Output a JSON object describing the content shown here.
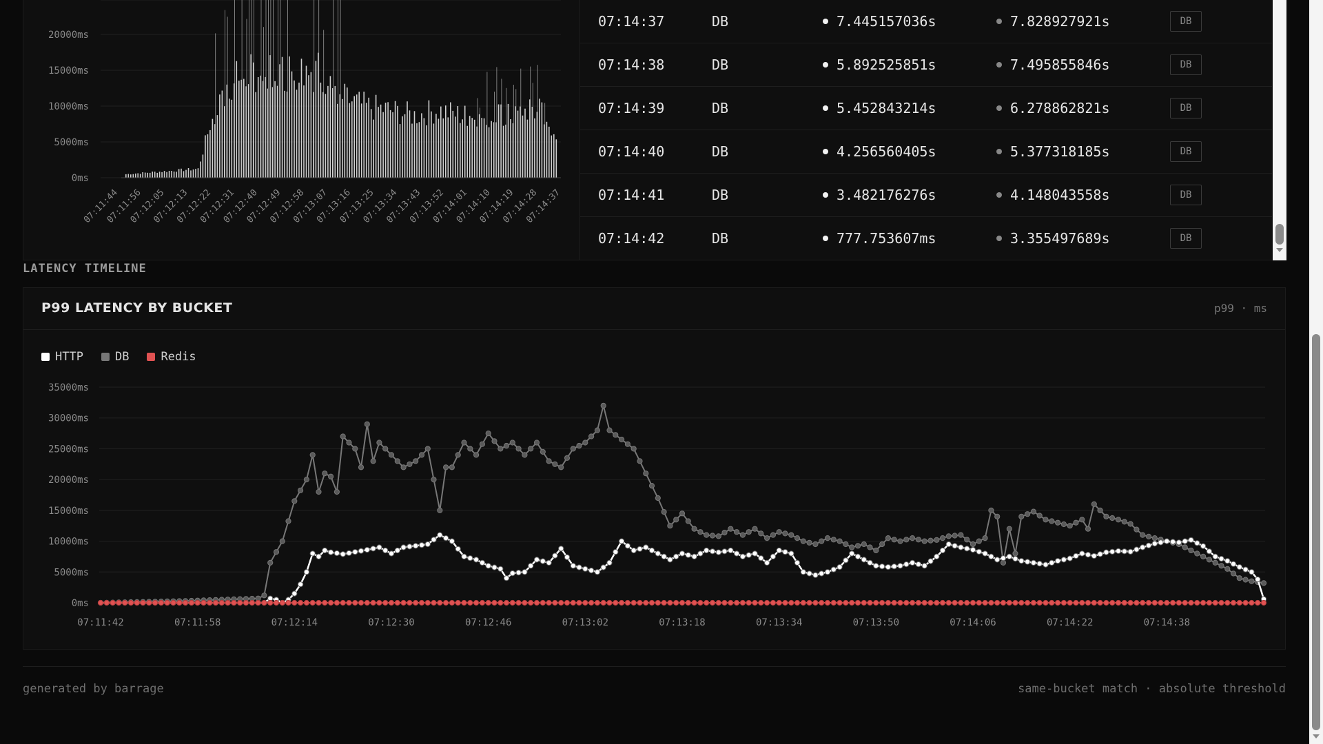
{
  "histogram": {
    "y_ticks": [
      "20000ms",
      "15000ms",
      "10000ms",
      "5000ms",
      "0ms"
    ],
    "x_ticks": [
      "07:11:44",
      "07:11:56",
      "07:12:05",
      "07:12:13",
      "07:12:22",
      "07:12:31",
      "07:12:40",
      "07:12:49",
      "07:12:58",
      "07:13:07",
      "07:13:16",
      "07:13:25",
      "07:13:34",
      "07:13:43",
      "07:13:52",
      "07:14:01",
      "07:14:10",
      "07:14:19",
      "07:14:28",
      "07:14:37"
    ]
  },
  "table": {
    "rows": [
      {
        "time": "07:14:37",
        "source": "DB",
        "v1": "7.445157036s",
        "v2": "7.828927921s",
        "tag": "DB"
      },
      {
        "time": "07:14:38",
        "source": "DB",
        "v1": "5.892525851s",
        "v2": "7.495855846s",
        "tag": "DB"
      },
      {
        "time": "07:14:39",
        "source": "DB",
        "v1": "5.452843214s",
        "v2": "6.278862821s",
        "tag": "DB"
      },
      {
        "time": "07:14:40",
        "source": "DB",
        "v1": "4.256560405s",
        "v2": "5.377318185s",
        "tag": "DB"
      },
      {
        "time": "07:14:41",
        "source": "DB",
        "v1": "3.482176276s",
        "v2": "4.148043558s",
        "tag": "DB"
      },
      {
        "time": "07:14:42",
        "source": "DB",
        "v1": "777.753607ms",
        "v2": "3.355497689s",
        "tag": "DB"
      }
    ]
  },
  "section_label": "LATENCY TIMELINE",
  "chart_panel": {
    "title": "P99 LATENCY BY BUCKET",
    "meta": "p99 · ms"
  },
  "chart_data": {
    "type": "line",
    "title": "P99 LATENCY BY BUCKET",
    "ylabel": "",
    "xlabel": "",
    "ylim": [
      0,
      35000
    ],
    "y_ticks": [
      0,
      5000,
      10000,
      15000,
      20000,
      25000,
      30000,
      35000
    ],
    "y_tick_labels": [
      "0ms",
      "5000ms",
      "10000ms",
      "15000ms",
      "20000ms",
      "25000ms",
      "30000ms",
      "35000ms"
    ],
    "x_tick_labels": [
      "07:11:42",
      "07:11:58",
      "07:12:14",
      "07:12:30",
      "07:12:46",
      "07:13:02",
      "07:13:18",
      "07:13:34",
      "07:13:50",
      "07:14:06",
      "07:14:22",
      "07:14:38"
    ],
    "grid": true,
    "legend": "top-left",
    "x_start": "07:11:42",
    "x_end": "07:14:42",
    "series": [
      {
        "name": "HTTP",
        "color": "#ffffff",
        "keyframes": [
          [
            0,
            0
          ],
          [
            27,
            0
          ],
          [
            28,
            700
          ],
          [
            29,
            500
          ],
          [
            30,
            0
          ],
          [
            31,
            500
          ],
          [
            32,
            1500
          ],
          [
            33,
            3000
          ],
          [
            34,
            5000
          ],
          [
            35,
            8000
          ],
          [
            36,
            7500
          ],
          [
            37,
            8500
          ],
          [
            38,
            8200
          ],
          [
            40,
            7900
          ],
          [
            44,
            8600
          ],
          [
            46,
            9000
          ],
          [
            48,
            8000
          ],
          [
            50,
            9000
          ],
          [
            54,
            9500
          ],
          [
            56,
            11000
          ],
          [
            58,
            10000
          ],
          [
            60,
            7500
          ],
          [
            62,
            7000
          ],
          [
            64,
            6000
          ],
          [
            66,
            5500
          ],
          [
            67,
            4000
          ],
          [
            68,
            4800
          ],
          [
            70,
            5000
          ],
          [
            72,
            7000
          ],
          [
            74,
            6500
          ],
          [
            76,
            8800
          ],
          [
            78,
            6000
          ],
          [
            80,
            5500
          ],
          [
            82,
            5000
          ],
          [
            84,
            6500
          ],
          [
            86,
            10000
          ],
          [
            88,
            8500
          ],
          [
            90,
            9000
          ],
          [
            92,
            8000
          ],
          [
            94,
            7000
          ],
          [
            96,
            8000
          ],
          [
            98,
            7500
          ],
          [
            100,
            8500
          ],
          [
            102,
            8200
          ],
          [
            104,
            8500
          ],
          [
            106,
            7500
          ],
          [
            108,
            8000
          ],
          [
            110,
            6500
          ],
          [
            112,
            8500
          ],
          [
            114,
            8000
          ],
          [
            116,
            5000
          ],
          [
            118,
            4500
          ],
          [
            120,
            5000
          ],
          [
            122,
            5800
          ],
          [
            124,
            8000
          ],
          [
            126,
            7000
          ],
          [
            128,
            6000
          ],
          [
            130,
            5800
          ],
          [
            132,
            6000
          ],
          [
            134,
            6500
          ],
          [
            136,
            6000
          ],
          [
            138,
            7500
          ],
          [
            140,
            9500
          ],
          [
            142,
            9000
          ],
          [
            144,
            8600
          ],
          [
            146,
            8000
          ],
          [
            148,
            7000
          ],
          [
            150,
            7500
          ],
          [
            152,
            6800
          ],
          [
            154,
            6500
          ],
          [
            156,
            6200
          ],
          [
            158,
            6800
          ],
          [
            160,
            7200
          ],
          [
            162,
            8000
          ],
          [
            164,
            7600
          ],
          [
            166,
            8200
          ],
          [
            168,
            8400
          ],
          [
            170,
            8300
          ],
          [
            172,
            9000
          ],
          [
            174,
            9600
          ],
          [
            176,
            10000
          ],
          [
            178,
            9800
          ],
          [
            180,
            10200
          ],
          [
            182,
            9200
          ],
          [
            184,
            7500
          ],
          [
            186,
            6800
          ],
          [
            188,
            5800
          ],
          [
            190,
            5000
          ],
          [
            191,
            3800
          ],
          [
            192,
            600
          ]
        ]
      },
      {
        "name": "DB",
        "color": "#777777",
        "keyframes": [
          [
            0,
            0
          ],
          [
            14,
            300
          ],
          [
            26,
            700
          ],
          [
            27,
            1200
          ],
          [
            28,
            6500
          ],
          [
            30,
            10000
          ],
          [
            32,
            16500
          ],
          [
            34,
            20000
          ],
          [
            35,
            24000
          ],
          [
            36,
            18000
          ],
          [
            37,
            21000
          ],
          [
            38,
            20500
          ],
          [
            39,
            18000
          ],
          [
            40,
            27000
          ],
          [
            42,
            25000
          ],
          [
            43,
            22000
          ],
          [
            44,
            29000
          ],
          [
            45,
            23000
          ],
          [
            46,
            26000
          ],
          [
            48,
            24000
          ],
          [
            50,
            22000
          ],
          [
            52,
            23000
          ],
          [
            54,
            25000
          ],
          [
            56,
            15000
          ],
          [
            57,
            22000
          ],
          [
            58,
            22000
          ],
          [
            60,
            26000
          ],
          [
            62,
            24000
          ],
          [
            64,
            27500
          ],
          [
            66,
            25000
          ],
          [
            68,
            26000
          ],
          [
            70,
            24000
          ],
          [
            72,
            26000
          ],
          [
            74,
            23000
          ],
          [
            76,
            22000
          ],
          [
            78,
            25000
          ],
          [
            80,
            26000
          ],
          [
            82,
            28000
          ],
          [
            83,
            32000
          ],
          [
            84,
            28000
          ],
          [
            86,
            26500
          ],
          [
            88,
            25000
          ],
          [
            90,
            21000
          ],
          [
            92,
            17000
          ],
          [
            94,
            12500
          ],
          [
            96,
            14500
          ],
          [
            98,
            12000
          ],
          [
            100,
            11000
          ],
          [
            102,
            10800
          ],
          [
            104,
            12000
          ],
          [
            106,
            11000
          ],
          [
            108,
            12000
          ],
          [
            110,
            10500
          ],
          [
            112,
            11500
          ],
          [
            114,
            11000
          ],
          [
            116,
            10000
          ],
          [
            118,
            9500
          ],
          [
            120,
            10500
          ],
          [
            122,
            10000
          ],
          [
            124,
            9000
          ],
          [
            126,
            9500
          ],
          [
            128,
            8500
          ],
          [
            130,
            10500
          ],
          [
            132,
            10000
          ],
          [
            134,
            10500
          ],
          [
            136,
            10000
          ],
          [
            138,
            10200
          ],
          [
            140,
            10800
          ],
          [
            142,
            11000
          ],
          [
            144,
            9500
          ],
          [
            146,
            10500
          ],
          [
            147,
            15000
          ],
          [
            148,
            14000
          ],
          [
            149,
            6500
          ],
          [
            150,
            12000
          ],
          [
            151,
            8000
          ],
          [
            152,
            14000
          ],
          [
            154,
            14800
          ],
          [
            156,
            13500
          ],
          [
            158,
            13000
          ],
          [
            160,
            12500
          ],
          [
            162,
            13500
          ],
          [
            163,
            12000
          ],
          [
            164,
            16000
          ],
          [
            166,
            14000
          ],
          [
            168,
            13500
          ],
          [
            170,
            12800
          ],
          [
            172,
            11000
          ],
          [
            174,
            10500
          ],
          [
            176,
            10000
          ],
          [
            178,
            9500
          ],
          [
            180,
            8500
          ],
          [
            182,
            7500
          ],
          [
            184,
            6500
          ],
          [
            186,
            5500
          ],
          [
            188,
            4000
          ],
          [
            190,
            3500
          ],
          [
            192,
            3200
          ]
        ]
      },
      {
        "name": "Redis",
        "color": "#e05252",
        "keyframes": [
          [
            0,
            0
          ],
          [
            192,
            0
          ]
        ]
      }
    ],
    "x_count": 193
  },
  "footer": {
    "left": "generated by barrage",
    "right": "same-bucket match · absolute threshold"
  }
}
